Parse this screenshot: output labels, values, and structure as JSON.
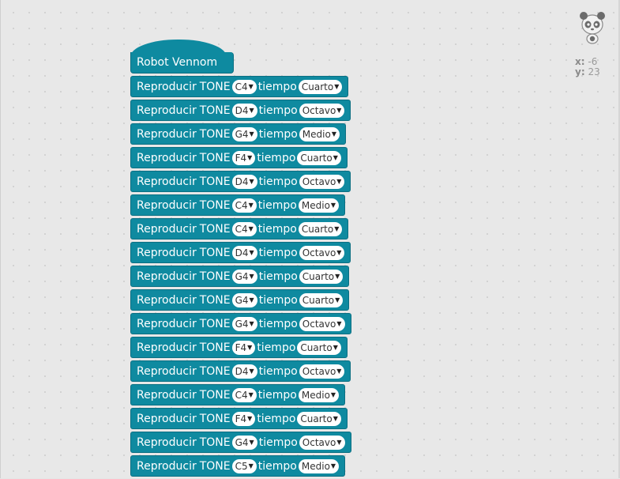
{
  "hat": {
    "label": "Robot Vennom"
  },
  "coords": {
    "x_label": "x:",
    "x_value": "-6",
    "y_label": "y:",
    "y_value": "23"
  },
  "blocks": [
    {
      "play": "Reproducir",
      "tone": "TONE",
      "note": "C4",
      "tiempo": "tiempo",
      "dur": "Cuarto"
    },
    {
      "play": "Reproducir",
      "tone": "TONE",
      "note": "D4",
      "tiempo": "tiempo",
      "dur": "Octavo"
    },
    {
      "play": "Reproducir",
      "tone": "TONE",
      "note": "G4",
      "tiempo": "tiempo",
      "dur": "Medio"
    },
    {
      "play": "Reproducir",
      "tone": "TONE",
      "note": "F4",
      "tiempo": "tiempo",
      "dur": "Cuarto"
    },
    {
      "play": "Reproducir",
      "tone": "TONE",
      "note": "D4",
      "tiempo": "tiempo",
      "dur": "Octavo"
    },
    {
      "play": "Reproducir",
      "tone": "TONE",
      "note": "C4",
      "tiempo": "tiempo",
      "dur": "Medio"
    },
    {
      "play": "Reproducir",
      "tone": "TONE",
      "note": "C4",
      "tiempo": "tiempo",
      "dur": "Cuarto"
    },
    {
      "play": "Reproducir",
      "tone": "TONE",
      "note": "D4",
      "tiempo": "tiempo",
      "dur": "Octavo"
    },
    {
      "play": "Reproducir",
      "tone": "TONE",
      "note": "G4",
      "tiempo": "tiempo",
      "dur": "Cuarto"
    },
    {
      "play": "Reproducir",
      "tone": "TONE",
      "note": "G4",
      "tiempo": "tiempo",
      "dur": "Cuarto"
    },
    {
      "play": "Reproducir",
      "tone": "TONE",
      "note": "G4",
      "tiempo": "tiempo",
      "dur": "Octavo"
    },
    {
      "play": "Reproducir",
      "tone": "TONE",
      "note": "F4",
      "tiempo": "tiempo",
      "dur": "Cuarto"
    },
    {
      "play": "Reproducir",
      "tone": "TONE",
      "note": "D4",
      "tiempo": "tiempo",
      "dur": "Octavo"
    },
    {
      "play": "Reproducir",
      "tone": "TONE",
      "note": "C4",
      "tiempo": "tiempo",
      "dur": "Medio"
    },
    {
      "play": "Reproducir",
      "tone": "TONE",
      "note": "F4",
      "tiempo": "tiempo",
      "dur": "Cuarto"
    },
    {
      "play": "Reproducir",
      "tone": "TONE",
      "note": "G4",
      "tiempo": "tiempo",
      "dur": "Octavo"
    },
    {
      "play": "Reproducir",
      "tone": "TONE",
      "note": "C5",
      "tiempo": "tiempo",
      "dur": "Medio"
    }
  ],
  "colors": {
    "block": "#0f8aa0",
    "block_border": "#0b6f82",
    "canvas": "#e8e8e8"
  },
  "icons": {
    "sprite": "panda-icon",
    "dropdown": "dropdown-arrow-icon"
  }
}
